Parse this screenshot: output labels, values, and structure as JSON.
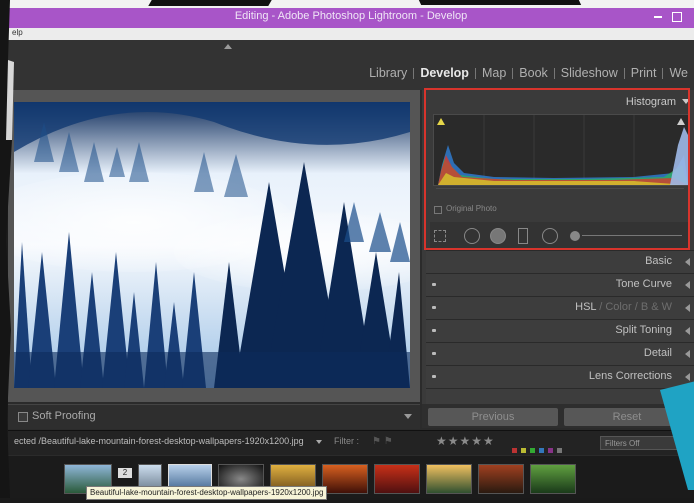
{
  "window": {
    "title": "Editing - Adobe Photoshop Lightroom - Develop",
    "menu_partial": "elp"
  },
  "modules": [
    "Library",
    "Develop",
    "Map",
    "Book",
    "Slideshow",
    "Print",
    "We"
  ],
  "active_module": "Develop",
  "histogram": {
    "title": "Histogram",
    "original_photo_label": "Original Photo"
  },
  "right_panels": [
    {
      "label": "Basic"
    },
    {
      "label": "Tone Curve"
    },
    {
      "label_parts": [
        "HSL",
        "Color",
        "B & W"
      ]
    },
    {
      "label": "Split Toning"
    },
    {
      "label": "Detail"
    },
    {
      "label": "Lens Corrections"
    }
  ],
  "buttons": {
    "previous": "Previous",
    "reset": "Reset"
  },
  "soft_proofing": {
    "label": "Soft Proofing"
  },
  "filter_bar": {
    "path": "ected  /Beautiful-lake-mountain-forest-desktop-wallpapers-1920x1200.jpg",
    "filter_label": "Filter :",
    "stars": "★★★★★",
    "filters_off": "Filters Off"
  },
  "filmstrip": {
    "tooltip": "Beautiful-lake-mountain-forest-desktop-wallpapers-1920x1200.jpg",
    "badge_count": "2"
  },
  "colors": {
    "titlebar": "#a855c8",
    "highlight_border": "#d8342c",
    "teal_overlay": "#1fa3c4"
  }
}
